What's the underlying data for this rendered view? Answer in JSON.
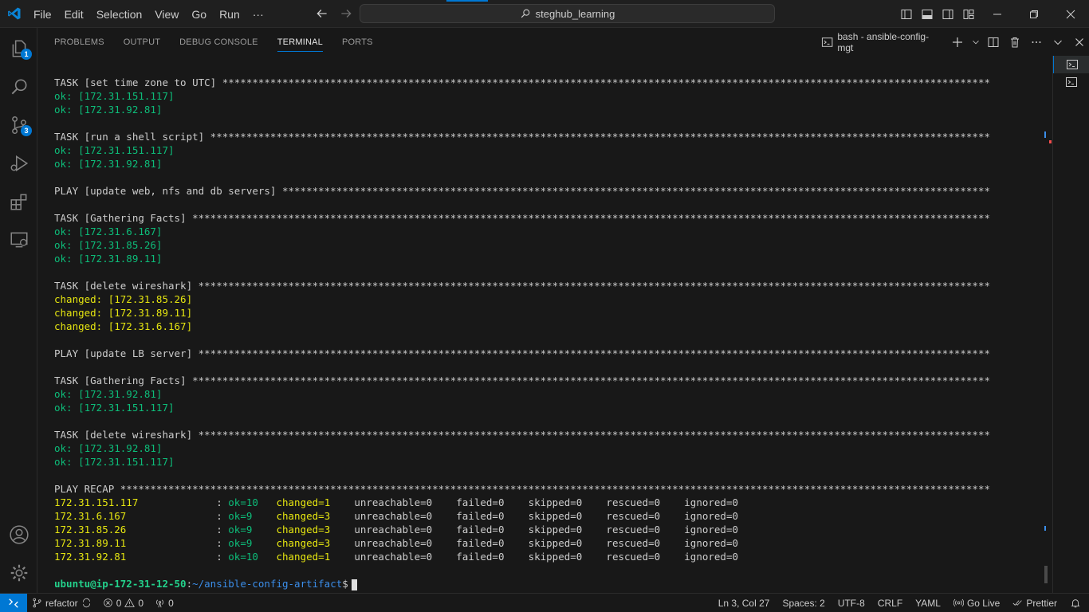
{
  "menu": [
    "File",
    "Edit",
    "Selection",
    "View",
    "Go",
    "Run",
    "···"
  ],
  "search": {
    "text": "steghub_learning"
  },
  "activity_badges": {
    "explorer": "1",
    "scm": "3"
  },
  "panel": {
    "tabs": [
      "PROBLEMS",
      "OUTPUT",
      "DEBUG CONSOLE",
      "TERMINAL",
      "PORTS"
    ],
    "active_tab": "TERMINAL",
    "terminal_name": "bash - ansible-config-mgt"
  },
  "terminal": {
    "lines": [
      {
        "type": "header",
        "text": "TASK [set time zone to UTC] ********************************************************************************************************************************"
      },
      {
        "type": "ok",
        "text": "ok: [172.31.151.117]"
      },
      {
        "type": "ok",
        "text": "ok: [172.31.92.81]"
      },
      {
        "type": "blank",
        "text": ""
      },
      {
        "type": "header",
        "text": "TASK [run a shell script] **********************************************************************************************************************************"
      },
      {
        "type": "ok",
        "text": "ok: [172.31.151.117]"
      },
      {
        "type": "ok",
        "text": "ok: [172.31.92.81]"
      },
      {
        "type": "blank",
        "text": ""
      },
      {
        "type": "header",
        "text": "PLAY [update web, nfs and db servers] **********************************************************************************************************************"
      },
      {
        "type": "blank",
        "text": ""
      },
      {
        "type": "header",
        "text": "TASK [Gathering Facts] *************************************************************************************************************************************"
      },
      {
        "type": "ok",
        "text": "ok: [172.31.6.167]"
      },
      {
        "type": "ok",
        "text": "ok: [172.31.85.26]"
      },
      {
        "type": "ok",
        "text": "ok: [172.31.89.11]"
      },
      {
        "type": "blank",
        "text": ""
      },
      {
        "type": "header",
        "text": "TASK [delete wireshark] ************************************************************************************************************************************"
      },
      {
        "type": "changed",
        "text": "changed: [172.31.85.26]"
      },
      {
        "type": "changed",
        "text": "changed: [172.31.89.11]"
      },
      {
        "type": "changed",
        "text": "changed: [172.31.6.167]"
      },
      {
        "type": "blank",
        "text": ""
      },
      {
        "type": "header",
        "text": "PLAY [update LB server] ************************************************************************************************************************************"
      },
      {
        "type": "blank",
        "text": ""
      },
      {
        "type": "header",
        "text": "TASK [Gathering Facts] *************************************************************************************************************************************"
      },
      {
        "type": "ok",
        "text": "ok: [172.31.92.81]"
      },
      {
        "type": "ok",
        "text": "ok: [172.31.151.117]"
      },
      {
        "type": "blank",
        "text": ""
      },
      {
        "type": "header",
        "text": "TASK [delete wireshark] ************************************************************************************************************************************"
      },
      {
        "type": "ok",
        "text": "ok: [172.31.92.81]"
      },
      {
        "type": "ok",
        "text": "ok: [172.31.151.117]"
      },
      {
        "type": "blank",
        "text": ""
      },
      {
        "type": "header",
        "text": "PLAY RECAP *************************************************************************************************************************************************"
      }
    ],
    "recap": [
      {
        "host": "172.31.151.117",
        "ok": "ok=10",
        "changed": "changed=1",
        "unreachable": "unreachable=0",
        "failed": "failed=0",
        "skipped": "skipped=0",
        "rescued": "rescued=0",
        "ignored": "ignored=0"
      },
      {
        "host": "172.31.6.167",
        "ok": "ok=9",
        "changed": "changed=3",
        "unreachable": "unreachable=0",
        "failed": "failed=0",
        "skipped": "skipped=0",
        "rescued": "rescued=0",
        "ignored": "ignored=0"
      },
      {
        "host": "172.31.85.26",
        "ok": "ok=9",
        "changed": "changed=3",
        "unreachable": "unreachable=0",
        "failed": "failed=0",
        "skipped": "skipped=0",
        "rescued": "rescued=0",
        "ignored": "ignored=0"
      },
      {
        "host": "172.31.89.11",
        "ok": "ok=9",
        "changed": "changed=3",
        "unreachable": "unreachable=0",
        "failed": "failed=0",
        "skipped": "skipped=0",
        "rescued": "rescued=0",
        "ignored": "ignored=0"
      },
      {
        "host": "172.31.92.81",
        "ok": "ok=10",
        "changed": "changed=1",
        "unreachable": "unreachable=0",
        "failed": "failed=0",
        "skipped": "skipped=0",
        "rescued": "rescued=0",
        "ignored": "ignored=0"
      }
    ],
    "prompt": {
      "user": "ubuntu@ip-172-31-12-50",
      "sep": ":",
      "path": "~/ansible-config-artifact",
      "symbol": "$"
    }
  },
  "status": {
    "branch": "refactor",
    "errors": "0",
    "warnings": "0",
    "ports": "0",
    "position": "Ln 3, Col 27",
    "spaces": "Spaces: 2",
    "encoding": "UTF-8",
    "eol": "CRLF",
    "language": "YAML",
    "golive": "Go Live",
    "prettier": "Prettier"
  },
  "colors": {
    "accent": "#0078d4",
    "ok": "#0dbc79",
    "changed": "#e5e510",
    "path": "#3b8eea"
  }
}
